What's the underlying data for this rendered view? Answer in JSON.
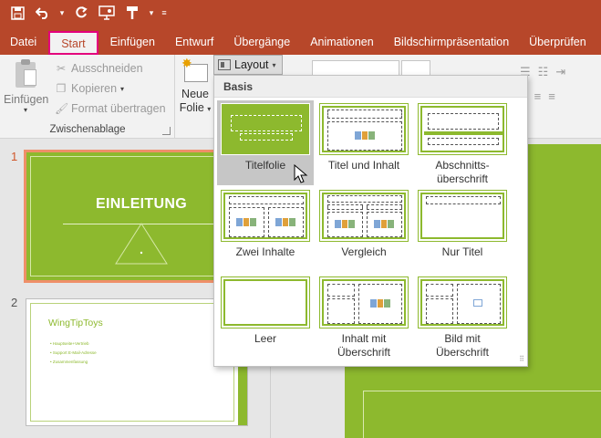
{
  "qat": {
    "save_icon": "save-icon",
    "undo_icon": "undo-icon",
    "redo_icon": "redo-icon",
    "present_icon": "present-from-start-icon",
    "brush_icon": "format-painter-icon",
    "customize_icon": "customize-qat-icon"
  },
  "tabs": [
    "Datei",
    "Start",
    "Einfügen",
    "Entwurf",
    "Übergänge",
    "Animationen",
    "Bildschirmpräsentation",
    "Überprüfen"
  ],
  "active_tab": "Start",
  "ribbon": {
    "paste_label": "Einfügen",
    "cut_label": "Ausschneiden",
    "copy_label": "Kopieren",
    "format_painter_label": "Format übertragen",
    "clipboard_group_label": "Zwischenablage",
    "new_slide_label_line1": "Neue",
    "new_slide_label_line2": "Folie",
    "layout_label": "Layout"
  },
  "gallery": {
    "header": "Basis",
    "items": [
      {
        "label": "Titelfolie",
        "selected": true
      },
      {
        "label": "Titel und Inhalt",
        "selected": false
      },
      {
        "label_line1": "Abschnitts-",
        "label_line2": "überschrift",
        "selected": false
      },
      {
        "label": "Zwei Inhalte",
        "selected": false
      },
      {
        "label": "Vergleich",
        "selected": false
      },
      {
        "label": "Nur Titel",
        "selected": false
      },
      {
        "label": "Leer",
        "selected": false
      },
      {
        "label_line1": "Inhalt mit",
        "label_line2": "Überschrift",
        "selected": false
      },
      {
        "label_line1": "Bild mit",
        "label_line2": "Überschrift",
        "selected": false
      }
    ]
  },
  "slides": [
    {
      "number": "1",
      "title": "EINLEITUNG",
      "selected": true
    },
    {
      "number": "2",
      "title": "WingTipToys",
      "bullets": [
        "Hauptseite+Vertrieb",
        "Support E-Mail-Adresse",
        "Zusammenfassung"
      ],
      "selected": false
    }
  ],
  "colors": {
    "accent": "#b7472a",
    "theme_green": "#8db92e",
    "highlight": "#e4007c",
    "selection_border": "#ef8f69"
  }
}
